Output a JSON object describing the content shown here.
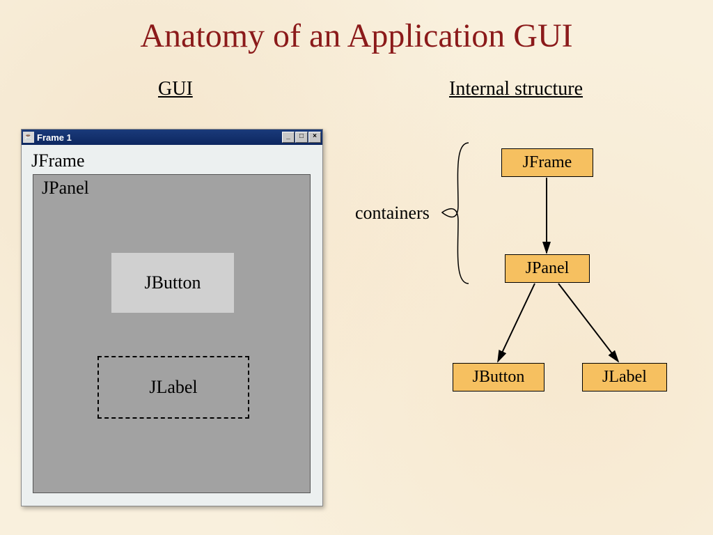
{
  "title": "Anatomy of an Application GUI",
  "columns": {
    "gui": "GUI",
    "structure": "Internal structure"
  },
  "window": {
    "title": "Frame 1",
    "buttons": {
      "min": "_",
      "max": "□",
      "close": "×"
    },
    "jframe_label": "JFrame",
    "jpanel_label": "JPanel",
    "jbutton_label": "JButton",
    "jlabel_label": "JLabel"
  },
  "tree": {
    "containers_label": "containers",
    "nodes": {
      "jframe": "JFrame",
      "jpanel": "JPanel",
      "jbutton": "JButton",
      "jlabel": "JLabel"
    }
  }
}
